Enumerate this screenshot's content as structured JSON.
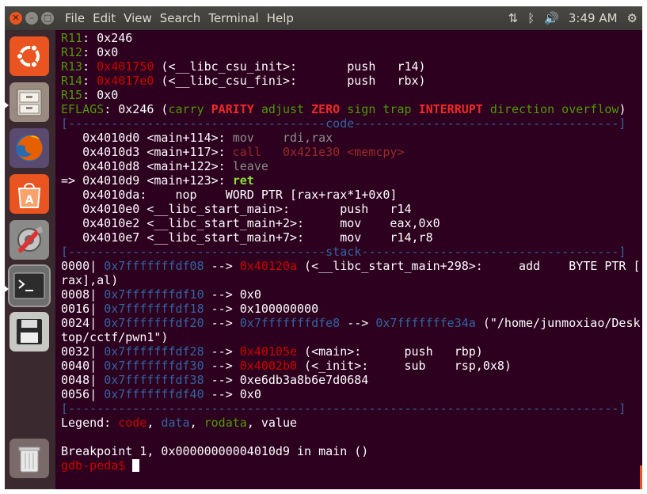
{
  "menubar": {
    "window_buttons": {
      "close": "✕",
      "minimize": "–",
      "maximize": "□"
    },
    "menus": [
      "File",
      "Edit",
      "View",
      "Search",
      "Terminal",
      "Help"
    ],
    "indicators": {
      "network_icon": "⇅",
      "bluetooth_icon": "ᛒ",
      "volume_icon": "🔊",
      "settings_icon": "⚙"
    },
    "clock": "3:49 AM"
  },
  "launcher": {
    "items": [
      "ubuntu-dash",
      "files",
      "firefox",
      "software-center",
      "system-settings",
      "terminal",
      "disks",
      "trash"
    ]
  },
  "colors": {
    "terminal_bg": "#2c001e",
    "orange": "#e95420",
    "green": "#4e9a06",
    "red": "#cc0000",
    "blue": "#3465a4"
  },
  "terminal": {
    "lines": [
      [
        {
          "t": "R11",
          "c": "c-green"
        },
        {
          "t": ": 0x246"
        }
      ],
      [
        {
          "t": "R12",
          "c": "c-green"
        },
        {
          "t": ": 0x0"
        }
      ],
      [
        {
          "t": "R13",
          "c": "c-green"
        },
        {
          "t": ": "
        },
        {
          "t": "0x401750",
          "c": "c-red"
        },
        {
          "t": " (<__libc_csu_init>:       push   r14)"
        }
      ],
      [
        {
          "t": "R14",
          "c": "c-green"
        },
        {
          "t": ": "
        },
        {
          "t": "0x4017e0",
          "c": "c-red"
        },
        {
          "t": " (<__libc_csu_fini>:       push   rbx)"
        }
      ],
      [
        {
          "t": "R15",
          "c": "c-green"
        },
        {
          "t": ": 0x0"
        }
      ],
      [
        {
          "t": "EFLAGS",
          "c": "c-green"
        },
        {
          "t": ": 0x246 ("
        },
        {
          "t": "carry ",
          "c": "c-green"
        },
        {
          "t": "PARITY",
          "c": "c-red-bold"
        },
        {
          "t": " adjust ",
          "c": "c-green"
        },
        {
          "t": "ZERO",
          "c": "c-red-bold"
        },
        {
          "t": " sign trap ",
          "c": "c-green"
        },
        {
          "t": "INTERRUPT",
          "c": "c-red-bold"
        },
        {
          "t": " direction overflow",
          "c": "c-green"
        },
        {
          "t": ")"
        }
      ],
      [
        {
          "t": "[------------------------------------code-------------------------------------]",
          "c": "c-blue"
        }
      ],
      [
        {
          "t": "   0x4010d0 <main+114>: "
        },
        {
          "t": "mov    rdi,rax",
          "c": "c-gray"
        }
      ],
      [
        {
          "t": "   0x4010d3 <main+117>: "
        },
        {
          "t": "call   0x421e30 <memcpy>",
          "c": "c-dimred"
        }
      ],
      [
        {
          "t": "   0x4010d8 <main+122>: "
        },
        {
          "t": "leave",
          "c": "c-gray"
        }
      ],
      [
        {
          "t": "=> 0x4010d9 <main+123>: "
        },
        {
          "t": "ret",
          "c": "c-green-bold"
        }
      ],
      [
        {
          "t": "   0x4010da:    nop    WORD PTR [rax+rax*1+0x0]"
        }
      ],
      [
        {
          "t": "   0x4010e0 <__libc_start_main>:       push   r14"
        }
      ],
      [
        {
          "t": "   0x4010e2 <__libc_start_main+2>:     mov    eax,0x0"
        }
      ],
      [
        {
          "t": "   0x4010e7 <__libc_start_main+7>:     mov    r14,r8"
        }
      ],
      [
        {
          "t": "[------------------------------------stack------------------------------------]",
          "c": "c-blue"
        }
      ],
      [
        {
          "t": "0000| "
        },
        {
          "t": "0x7fffffffdf08",
          "c": "c-blue"
        },
        {
          "t": " --> "
        },
        {
          "t": "0x40120a",
          "c": "c-red"
        },
        {
          "t": " (<__libc_start_main+298>:     add    BYTE PTR ["
        }
      ],
      [
        {
          "t": "rax],al)"
        }
      ],
      [
        {
          "t": "0008| "
        },
        {
          "t": "0x7fffffffdf10",
          "c": "c-blue"
        },
        {
          "t": " --> 0x0"
        }
      ],
      [
        {
          "t": "0016| "
        },
        {
          "t": "0x7fffffffdf18",
          "c": "c-blue"
        },
        {
          "t": " --> 0x100000000"
        }
      ],
      [
        {
          "t": "0024| "
        },
        {
          "t": "0x7fffffffdf20",
          "c": "c-blue"
        },
        {
          "t": " --> "
        },
        {
          "t": "0x7fffffffdfe8",
          "c": "c-blue"
        },
        {
          "t": " --> "
        },
        {
          "t": "0x7fffffffe34a",
          "c": "c-blue"
        },
        {
          "t": " (\"/home/junmoxiao/Desk"
        }
      ],
      [
        {
          "t": "top/cctf/pwn1\")"
        }
      ],
      [
        {
          "t": "0032| "
        },
        {
          "t": "0x7fffffffdf28",
          "c": "c-blue"
        },
        {
          "t": " --> "
        },
        {
          "t": "0x40105e",
          "c": "c-red"
        },
        {
          "t": " (<main>:      push   rbp)"
        }
      ],
      [
        {
          "t": "0040| "
        },
        {
          "t": "0x7fffffffdf30",
          "c": "c-blue"
        },
        {
          "t": " --> "
        },
        {
          "t": "0x4002b0",
          "c": "c-red"
        },
        {
          "t": " (<_init>:     sub    rsp,0x8)"
        }
      ],
      [
        {
          "t": "0048| "
        },
        {
          "t": "0x7fffffffdf38",
          "c": "c-blue"
        },
        {
          "t": " --> 0xe6db3a8b6e7d0684"
        }
      ],
      [
        {
          "t": "0056| "
        },
        {
          "t": "0x7fffffffdf40",
          "c": "c-blue"
        },
        {
          "t": " --> 0x0"
        }
      ],
      [
        {
          "t": "[-----------------------------------------------------------------------------]",
          "c": "c-blue"
        }
      ],
      [
        {
          "t": "Legend: "
        },
        {
          "t": "code",
          "c": "c-red"
        },
        {
          "t": ", "
        },
        {
          "t": "data",
          "c": "c-blue"
        },
        {
          "t": ", "
        },
        {
          "t": "rodata",
          "c": "c-green"
        },
        {
          "t": ", value"
        }
      ],
      [
        {
          "t": ""
        }
      ],
      [
        {
          "t": "Breakpoint 1, 0x00000000004010d9 in main ()"
        }
      ],
      [
        {
          "t": "gdb-peda$ ",
          "c": "c-red"
        }
      ]
    ]
  }
}
